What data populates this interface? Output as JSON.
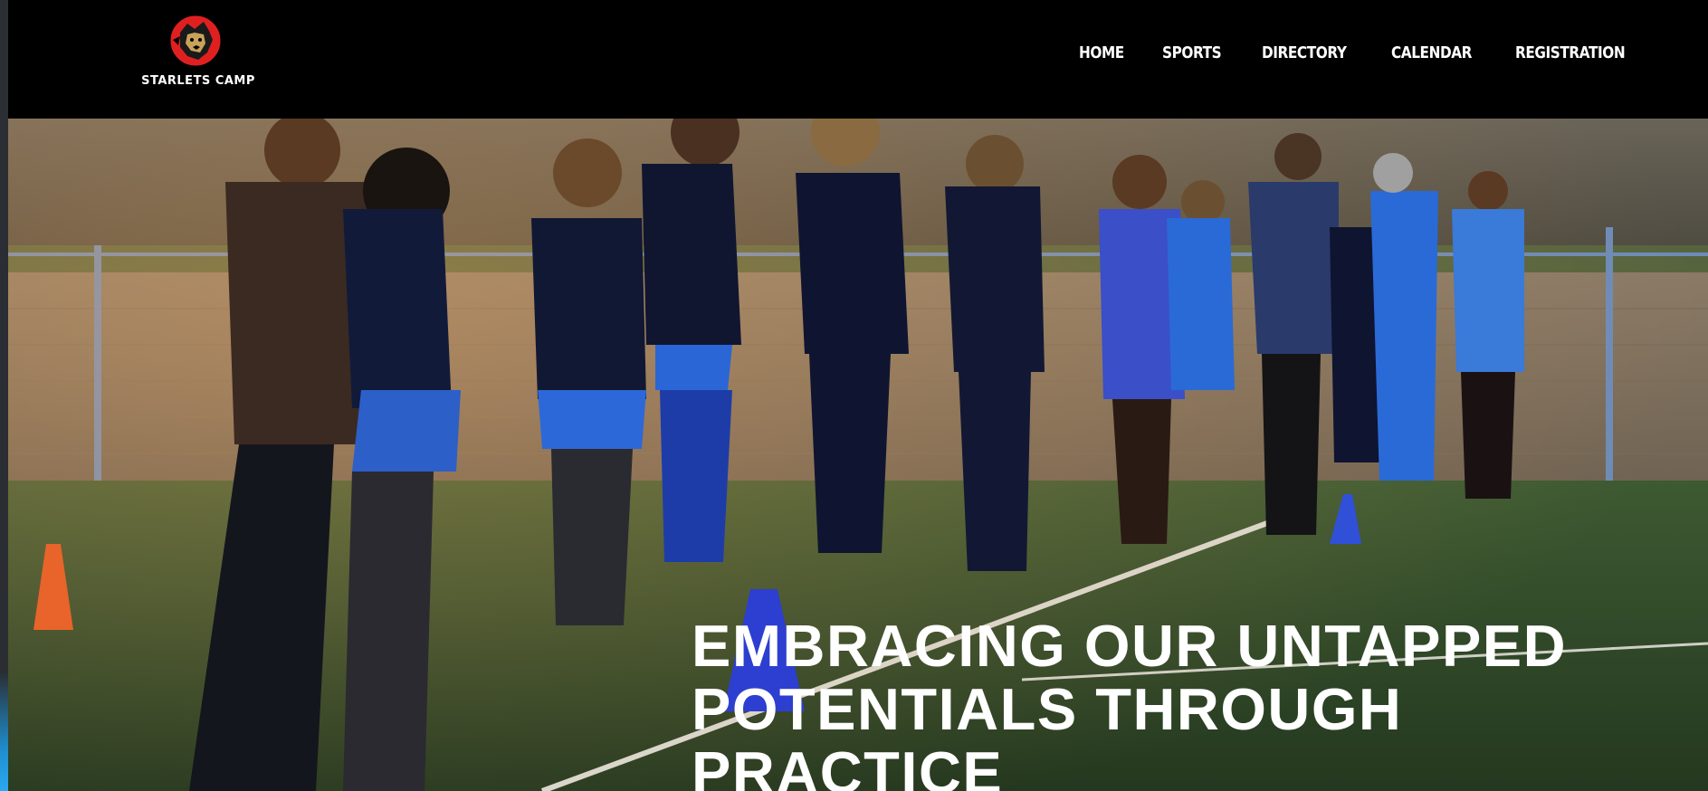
{
  "brand": {
    "name": "STARLETS CAMP",
    "logo_icon": "lion-head-icon",
    "logo_color": "#e02020"
  },
  "nav": {
    "items": [
      {
        "label": "HOME"
      },
      {
        "label": "SPORTS"
      },
      {
        "label": "DIRECTORY"
      },
      {
        "label": "CALENDAR"
      },
      {
        "label": "REGISTRATION"
      }
    ]
  },
  "hero": {
    "headline_lines": [
      "EMBRACING OUR UNTAPPED",
      "POTENTIALS THROUGH",
      "PRACTICE"
    ],
    "photo_subject": "youth football players lined up on a pitch"
  },
  "colors": {
    "header_bg": "#000000",
    "text": "#ffffff",
    "jersey_blue": "#1f4fb0",
    "pitch_green": "#2f4a2a"
  }
}
